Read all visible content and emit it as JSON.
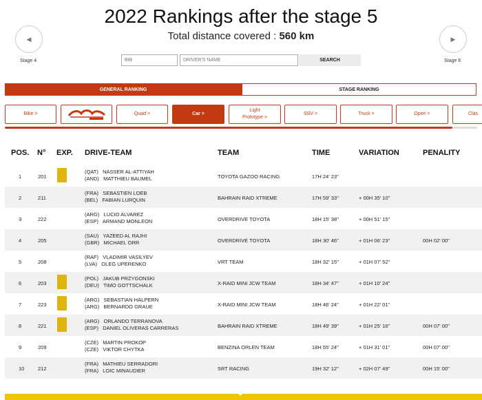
{
  "page": {
    "title": "2022 Rankings after the stage 5",
    "distance_label": "Total distance covered : ",
    "distance_value": "560 km"
  },
  "nav": {
    "prev_label": "Stage 4",
    "next_label": "Stage 6",
    "prev_glyph": "◀",
    "next_glyph": "▶"
  },
  "search": {
    "bib_placeholder": "BIB",
    "name_placeholder": "DRIVER'S NAME",
    "button_label": "SEARCH"
  },
  "ranking_tabs": {
    "general": "GENERAL RANKING",
    "stage": "STAGE RANKING"
  },
  "categories": [
    {
      "label": "Bike >",
      "active": false
    },
    {
      "label": "",
      "active": false,
      "logo": true
    },
    {
      "label": "Quad >",
      "active": false
    },
    {
      "label": "Car >",
      "active": true
    },
    {
      "label": "Light\nPrototype >",
      "active": false
    },
    {
      "label": "SSV >",
      "active": false
    },
    {
      "label": "Truck >",
      "active": false
    },
    {
      "label": "Open >",
      "active": false
    },
    {
      "label": "Clas",
      "active": false
    }
  ],
  "colors": {
    "accent": "#c23a14",
    "expert_badge": "#e1b40b",
    "bottom_bar": "#f0c400"
  },
  "table": {
    "headers": {
      "pos": "POS.",
      "num": "N°",
      "exp": "EXP.",
      "drive_team": "DRIVE-TEAM",
      "team": "TEAM",
      "time": "TIME",
      "variation": "VARIATION",
      "penalty": "PENALITY"
    },
    "rows": [
      {
        "pos": "1",
        "num": "201",
        "exp": true,
        "driver1": "(QAT)   NASSER AL-ATTIYAH",
        "driver2": "(AND)   MATTHIEU BAUMEL",
        "team": "TOYOTA GAZOO RACING",
        "time": "17H 24' 23''",
        "variation": "",
        "penalty": ""
      },
      {
        "pos": "2",
        "num": "211",
        "exp": false,
        "driver1": "(FRA)   SEBASTIEN LOEB",
        "driver2": "(BEL)   FABIAN LURQUIN",
        "team": "BAHRAIN RAID XTREME",
        "time": "17H 59' 33''",
        "variation": "+ 00H 35' 10''",
        "penalty": ""
      },
      {
        "pos": "3",
        "num": "222",
        "exp": false,
        "driver1": "(ARG)   LUCIO ALVAREZ",
        "driver2": "(ESP)   ARMAND MONLEON",
        "team": "OVERDRIVE TOYOTA",
        "time": "18H 15' 38''",
        "variation": "+ 00H 51' 15''",
        "penalty": ""
      },
      {
        "pos": "4",
        "num": "205",
        "exp": false,
        "driver1": "(SAU)   YAZEED AL RAJHI",
        "driver2": "(GBR)   MICHAEL ORR",
        "team": "OVERDRIVE TOYOTA",
        "time": "18H 30' 46''",
        "variation": "+ 01H 06' 23''",
        "penalty": "00H 02' 00''"
      },
      {
        "pos": "5",
        "num": "208",
        "exp": false,
        "driver1": "(RAF)   VLADIMIR VASILYEV",
        "driver2": "(LVA)   OLEG UPERENKO",
        "team": "VRT TEAM",
        "time": "18H 32' 15''",
        "variation": "+ 01H 07' 52''",
        "penalty": ""
      },
      {
        "pos": "6",
        "num": "203",
        "exp": true,
        "driver1": "(POL)   JAKUB PRZYGONSKI",
        "driver2": "(DEU)   TIMO GOTTSCHALK",
        "team": "X-RAID MINI JCW TEAM",
        "time": "18H 34' 47''",
        "variation": "+ 01H 10' 24''",
        "penalty": ""
      },
      {
        "pos": "7",
        "num": "223",
        "exp": true,
        "driver1": "(ARG)   SEBASTIAN HALPERN",
        "driver2": "(ARG)   BERNARDO GRAUE",
        "team": "X-RAID MINI JCW TEAM",
        "time": "18H 46' 24''",
        "variation": "+ 01H 22' 01''",
        "penalty": ""
      },
      {
        "pos": "8",
        "num": "221",
        "exp": true,
        "driver1": "(ARG)   ORLANDO TERRANOVA",
        "driver2": "(ESP)   DANIEL OLIVERAS CARRERAS",
        "team": "BAHRAIN RAID XTREME",
        "time": "18H 49' 39''",
        "variation": "+ 01H 25' 16''",
        "penalty": "00H 07' 00''"
      },
      {
        "pos": "9",
        "num": "209",
        "exp": false,
        "driver1": "(CZE)   MARTIN PROKOP",
        "driver2": "(CZE)   VIKTOR CHYTKA",
        "team": "BENZINA ORLEN TEAM",
        "time": "18H 55' 24''",
        "variation": "+ 01H 31' 01''",
        "penalty": "00H 07' 00''"
      },
      {
        "pos": "10",
        "num": "212",
        "exp": false,
        "driver1": "(FRA)   MATHIEU SERRADORI",
        "driver2": "(FRA)   LOIC MINAUDIER",
        "team": "SRT RACING",
        "time": "19H 32' 12''",
        "variation": "+ 02H 07' 49''",
        "penalty": "00H 15' 00''"
      }
    ]
  }
}
